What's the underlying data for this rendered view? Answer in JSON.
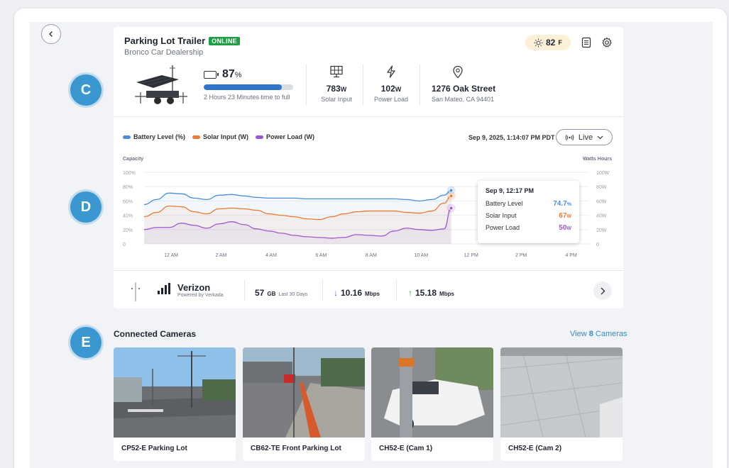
{
  "device": {
    "name": "Parking Lot Trailer",
    "status": "ONLINE",
    "location_name": "Bronco Car Dealership",
    "weather": {
      "temp": "82",
      "unit": "F",
      "icon": "sun-icon"
    }
  },
  "battery": {
    "percent": "87",
    "percent_unit": "%",
    "fill_percent": 87,
    "note": "2 Hours 23 Minutes time to full"
  },
  "solar": {
    "value": "783",
    "unit": "W",
    "label": "Solar Input"
  },
  "power": {
    "value": "102",
    "unit": "W",
    "label": "Power Load"
  },
  "address": {
    "street": "1276 Oak Street",
    "city": "San Mateo, CA 94401"
  },
  "markers": [
    "C",
    "D",
    "E"
  ],
  "chart_header": {
    "datetime": "Sep 9, 2025, 1:14:07 PM PDT",
    "live_label": "Live"
  },
  "chart_data": {
    "type": "area",
    "left_axis_title": "Capacity",
    "right_axis_title": "Watts Hours",
    "left_ticks": [
      "100%",
      "80%",
      "60%",
      "40%",
      "20%",
      "0"
    ],
    "right_ticks": [
      "100W",
      "80W",
      "60W",
      "40W",
      "20W",
      "0"
    ],
    "x_ticks": [
      "12 AM",
      "2 AM",
      "4 AM",
      "6 AM",
      "8 AM",
      "10 AM",
      "12 PM",
      "2 PM",
      "4 PM"
    ],
    "ylim": [
      0,
      100
    ],
    "series": [
      {
        "name": "Battery Level (%)",
        "color": "#4a8fd9",
        "x": [
          0,
          0.5,
          1,
          1.5,
          2,
          2.5,
          3,
          3.5,
          4,
          4.5,
          5,
          5.5,
          6,
          6.5,
          7,
          7.5,
          8,
          8.5,
          9,
          9.5,
          10,
          10.5,
          11,
          11.5,
          12,
          12.28
        ],
        "values": [
          55,
          62,
          71,
          70,
          64,
          62,
          68,
          69,
          67,
          65,
          64,
          64,
          64,
          63,
          63,
          63,
          63,
          63,
          63,
          63,
          63,
          62,
          60,
          62,
          68,
          74.7
        ]
      },
      {
        "name": "Solar Input (W)",
        "color": "#f07a30",
        "x": [
          0,
          0.5,
          1,
          1.5,
          2,
          2.5,
          3,
          3.5,
          4,
          4.5,
          5,
          5.5,
          6,
          6.5,
          7,
          7.5,
          8,
          8.5,
          9,
          9.5,
          10,
          10.5,
          11,
          11.5,
          12,
          12.28
        ],
        "values": [
          38,
          44,
          53,
          52,
          45,
          42,
          49,
          50,
          49,
          47,
          42,
          40,
          38,
          35,
          34,
          38,
          42,
          45,
          46,
          46,
          46,
          44,
          43,
          46,
          57,
          67
        ]
      },
      {
        "name": "Power Load (W)",
        "color": "#9b59d0",
        "x": [
          0,
          0.5,
          1,
          1.5,
          2,
          2.5,
          3,
          3.5,
          4,
          4.5,
          5,
          5.5,
          6,
          6.5,
          7,
          7.5,
          8,
          8.5,
          9,
          9.5,
          10,
          10.5,
          11,
          11.5,
          12,
          12.28
        ],
        "values": [
          20,
          23,
          23,
          29,
          26,
          22,
          28,
          31,
          27,
          21,
          18,
          15,
          12,
          10,
          9,
          8,
          9,
          13,
          12,
          11,
          18,
          22,
          20,
          19,
          21,
          50
        ]
      }
    ],
    "highlight": {
      "x": 12.28,
      "title": "Sep 9, 12:17 PM",
      "rows": [
        {
          "label": "Battery Level",
          "value": "74.7",
          "unit": "%",
          "color": "#4a8fd9"
        },
        {
          "label": "Solar Input",
          "value": "67",
          "unit": "W",
          "color": "#f07a30"
        },
        {
          "label": "Power Load",
          "value": "50",
          "unit": "W",
          "color": "#9b59d0"
        }
      ]
    },
    "grid": true,
    "legend": "top-left"
  },
  "network": {
    "carrier": "Verizon",
    "powered_by": "Powered by Verkada",
    "data_used": "57",
    "data_unit": "GB",
    "data_period": "Last 30 Days",
    "download": "10.16",
    "upload": "15.18",
    "speed_unit": "Mbps"
  },
  "cameras": {
    "title": "Connected Cameras",
    "view_prefix": "View",
    "count": "8",
    "view_suffix": "Cameras",
    "items": [
      {
        "name": "CP52-E Parking Lot"
      },
      {
        "name": "CB62-TE Front Parking Lot"
      },
      {
        "name": "CH52-E (Cam 1)"
      },
      {
        "name": "CH52-E (Cam 2)"
      }
    ]
  }
}
